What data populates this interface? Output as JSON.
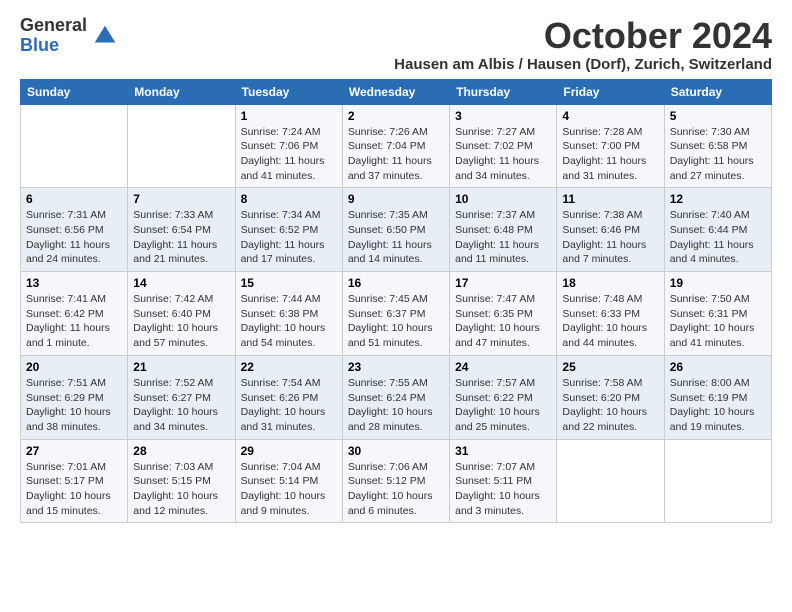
{
  "logo": {
    "general": "General",
    "blue": "Blue"
  },
  "title": "October 2024",
  "location": "Hausen am Albis / Hausen (Dorf), Zurich, Switzerland",
  "weekdays": [
    "Sunday",
    "Monday",
    "Tuesday",
    "Wednesday",
    "Thursday",
    "Friday",
    "Saturday"
  ],
  "weeks": [
    [
      {
        "day": "",
        "sunrise": "",
        "sunset": "",
        "daylight": ""
      },
      {
        "day": "",
        "sunrise": "",
        "sunset": "",
        "daylight": ""
      },
      {
        "day": "1",
        "sunrise": "Sunrise: 7:24 AM",
        "sunset": "Sunset: 7:06 PM",
        "daylight": "Daylight: 11 hours and 41 minutes."
      },
      {
        "day": "2",
        "sunrise": "Sunrise: 7:26 AM",
        "sunset": "Sunset: 7:04 PM",
        "daylight": "Daylight: 11 hours and 37 minutes."
      },
      {
        "day": "3",
        "sunrise": "Sunrise: 7:27 AM",
        "sunset": "Sunset: 7:02 PM",
        "daylight": "Daylight: 11 hours and 34 minutes."
      },
      {
        "day": "4",
        "sunrise": "Sunrise: 7:28 AM",
        "sunset": "Sunset: 7:00 PM",
        "daylight": "Daylight: 11 hours and 31 minutes."
      },
      {
        "day": "5",
        "sunrise": "Sunrise: 7:30 AM",
        "sunset": "Sunset: 6:58 PM",
        "daylight": "Daylight: 11 hours and 27 minutes."
      }
    ],
    [
      {
        "day": "6",
        "sunrise": "Sunrise: 7:31 AM",
        "sunset": "Sunset: 6:56 PM",
        "daylight": "Daylight: 11 hours and 24 minutes."
      },
      {
        "day": "7",
        "sunrise": "Sunrise: 7:33 AM",
        "sunset": "Sunset: 6:54 PM",
        "daylight": "Daylight: 11 hours and 21 minutes."
      },
      {
        "day": "8",
        "sunrise": "Sunrise: 7:34 AM",
        "sunset": "Sunset: 6:52 PM",
        "daylight": "Daylight: 11 hours and 17 minutes."
      },
      {
        "day": "9",
        "sunrise": "Sunrise: 7:35 AM",
        "sunset": "Sunset: 6:50 PM",
        "daylight": "Daylight: 11 hours and 14 minutes."
      },
      {
        "day": "10",
        "sunrise": "Sunrise: 7:37 AM",
        "sunset": "Sunset: 6:48 PM",
        "daylight": "Daylight: 11 hours and 11 minutes."
      },
      {
        "day": "11",
        "sunrise": "Sunrise: 7:38 AM",
        "sunset": "Sunset: 6:46 PM",
        "daylight": "Daylight: 11 hours and 7 minutes."
      },
      {
        "day": "12",
        "sunrise": "Sunrise: 7:40 AM",
        "sunset": "Sunset: 6:44 PM",
        "daylight": "Daylight: 11 hours and 4 minutes."
      }
    ],
    [
      {
        "day": "13",
        "sunrise": "Sunrise: 7:41 AM",
        "sunset": "Sunset: 6:42 PM",
        "daylight": "Daylight: 11 hours and 1 minute."
      },
      {
        "day": "14",
        "sunrise": "Sunrise: 7:42 AM",
        "sunset": "Sunset: 6:40 PM",
        "daylight": "Daylight: 10 hours and 57 minutes."
      },
      {
        "day": "15",
        "sunrise": "Sunrise: 7:44 AM",
        "sunset": "Sunset: 6:38 PM",
        "daylight": "Daylight: 10 hours and 54 minutes."
      },
      {
        "day": "16",
        "sunrise": "Sunrise: 7:45 AM",
        "sunset": "Sunset: 6:37 PM",
        "daylight": "Daylight: 10 hours and 51 minutes."
      },
      {
        "day": "17",
        "sunrise": "Sunrise: 7:47 AM",
        "sunset": "Sunset: 6:35 PM",
        "daylight": "Daylight: 10 hours and 47 minutes."
      },
      {
        "day": "18",
        "sunrise": "Sunrise: 7:48 AM",
        "sunset": "Sunset: 6:33 PM",
        "daylight": "Daylight: 10 hours and 44 minutes."
      },
      {
        "day": "19",
        "sunrise": "Sunrise: 7:50 AM",
        "sunset": "Sunset: 6:31 PM",
        "daylight": "Daylight: 10 hours and 41 minutes."
      }
    ],
    [
      {
        "day": "20",
        "sunrise": "Sunrise: 7:51 AM",
        "sunset": "Sunset: 6:29 PM",
        "daylight": "Daylight: 10 hours and 38 minutes."
      },
      {
        "day": "21",
        "sunrise": "Sunrise: 7:52 AM",
        "sunset": "Sunset: 6:27 PM",
        "daylight": "Daylight: 10 hours and 34 minutes."
      },
      {
        "day": "22",
        "sunrise": "Sunrise: 7:54 AM",
        "sunset": "Sunset: 6:26 PM",
        "daylight": "Daylight: 10 hours and 31 minutes."
      },
      {
        "day": "23",
        "sunrise": "Sunrise: 7:55 AM",
        "sunset": "Sunset: 6:24 PM",
        "daylight": "Daylight: 10 hours and 28 minutes."
      },
      {
        "day": "24",
        "sunrise": "Sunrise: 7:57 AM",
        "sunset": "Sunset: 6:22 PM",
        "daylight": "Daylight: 10 hours and 25 minutes."
      },
      {
        "day": "25",
        "sunrise": "Sunrise: 7:58 AM",
        "sunset": "Sunset: 6:20 PM",
        "daylight": "Daylight: 10 hours and 22 minutes."
      },
      {
        "day": "26",
        "sunrise": "Sunrise: 8:00 AM",
        "sunset": "Sunset: 6:19 PM",
        "daylight": "Daylight: 10 hours and 19 minutes."
      }
    ],
    [
      {
        "day": "27",
        "sunrise": "Sunrise: 7:01 AM",
        "sunset": "Sunset: 5:17 PM",
        "daylight": "Daylight: 10 hours and 15 minutes."
      },
      {
        "day": "28",
        "sunrise": "Sunrise: 7:03 AM",
        "sunset": "Sunset: 5:15 PM",
        "daylight": "Daylight: 10 hours and 12 minutes."
      },
      {
        "day": "29",
        "sunrise": "Sunrise: 7:04 AM",
        "sunset": "Sunset: 5:14 PM",
        "daylight": "Daylight: 10 hours and 9 minutes."
      },
      {
        "day": "30",
        "sunrise": "Sunrise: 7:06 AM",
        "sunset": "Sunset: 5:12 PM",
        "daylight": "Daylight: 10 hours and 6 minutes."
      },
      {
        "day": "31",
        "sunrise": "Sunrise: 7:07 AM",
        "sunset": "Sunset: 5:11 PM",
        "daylight": "Daylight: 10 hours and 3 minutes."
      },
      {
        "day": "",
        "sunrise": "",
        "sunset": "",
        "daylight": ""
      },
      {
        "day": "",
        "sunrise": "",
        "sunset": "",
        "daylight": ""
      }
    ]
  ]
}
